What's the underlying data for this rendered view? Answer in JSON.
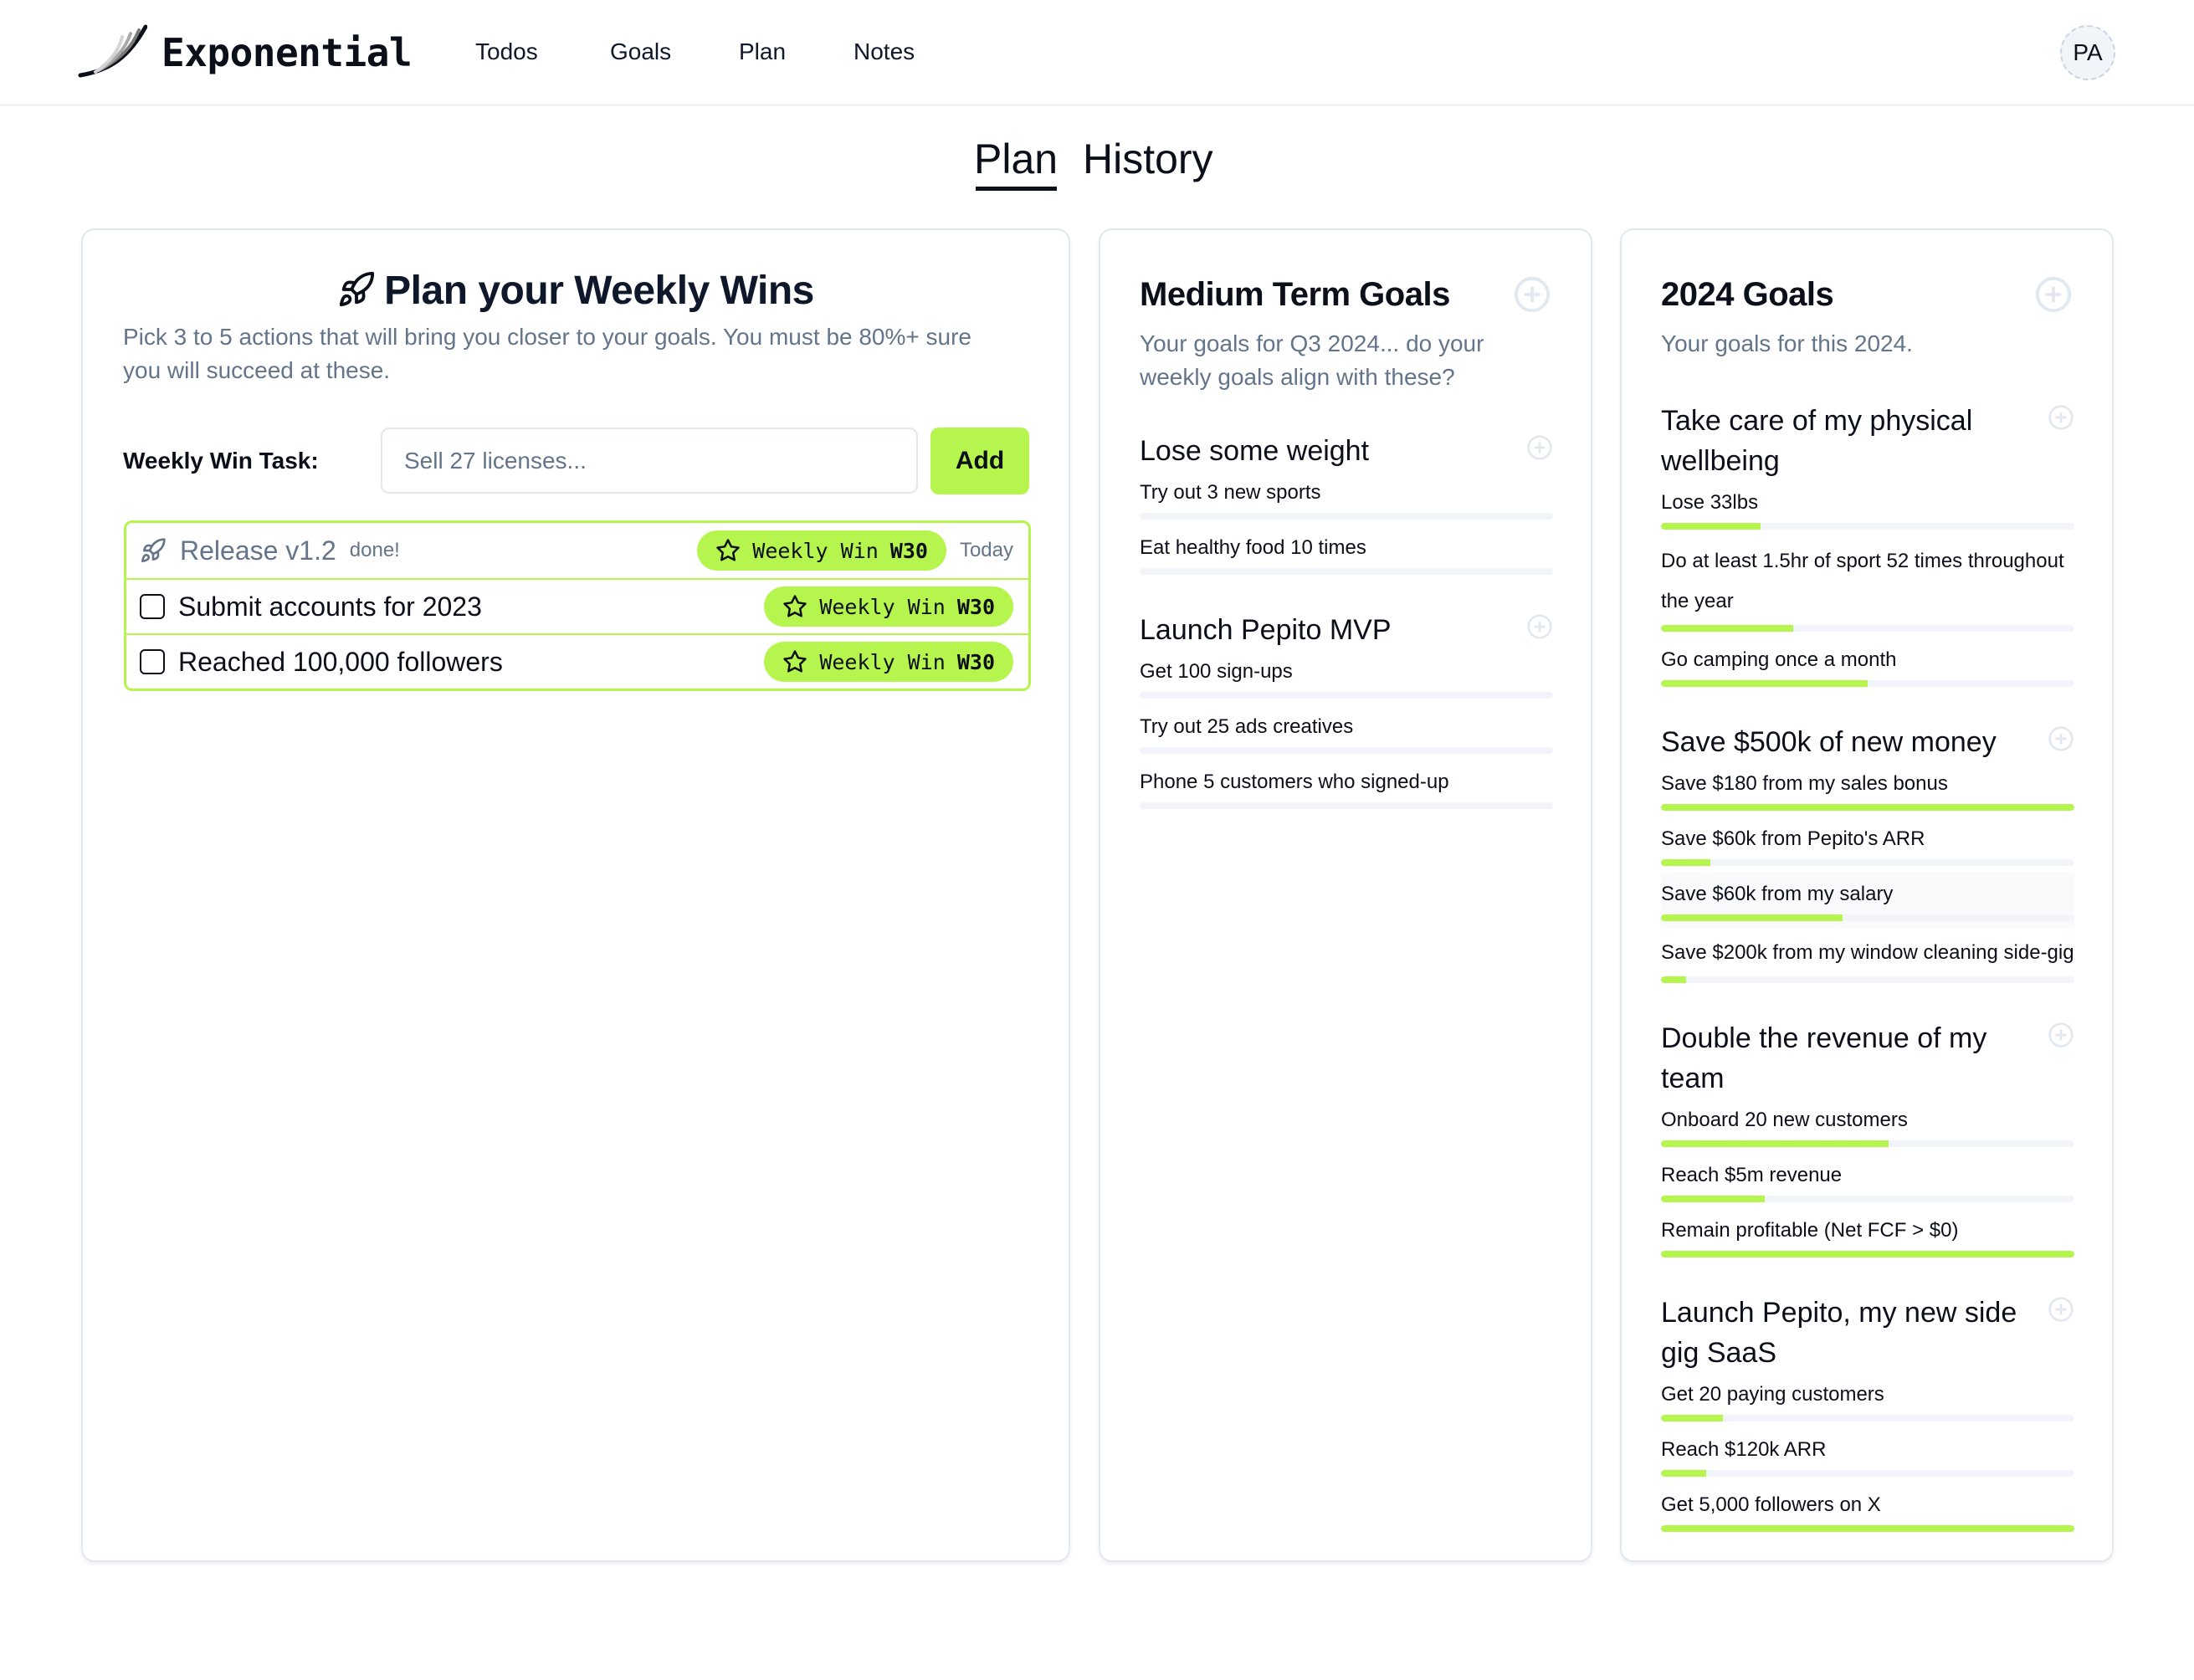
{
  "header": {
    "brand": "Exponential",
    "nav": [
      "Todos",
      "Goals",
      "Plan",
      "Notes"
    ],
    "avatar_initials": "PA"
  },
  "tabs": [
    {
      "label": "Plan",
      "active": true
    },
    {
      "label": "History",
      "active": false
    }
  ],
  "plan": {
    "title": "Plan your Weekly Wins",
    "title_icon": "rocket-icon",
    "description": "Pick 3 to 5 actions that will bring you closer to your goals. You must be 80%+ sure you will succeed at these.",
    "task_label": "Weekly Win Task:",
    "task_input_value": "",
    "task_input_placeholder": "Sell 27 licenses...",
    "add_label": "Add",
    "tasks": [
      {
        "text": "Release v1.2",
        "done": true,
        "done_label": "done!",
        "badge_label": "Weekly Win",
        "badge_week": "W30",
        "date": "Today"
      },
      {
        "text": "Submit accounts for 2023",
        "done": false,
        "badge_label": "Weekly Win",
        "badge_week": "W30"
      },
      {
        "text": "Reached 100,000 followers",
        "done": false,
        "badge_label": "Weekly Win",
        "badge_week": "W30"
      }
    ]
  },
  "medium_term": {
    "title": "Medium Term Goals",
    "description": "Your goals for Q3 2024... do your weekly goals align with these?",
    "goals": [
      {
        "title": "Lose some weight",
        "items": [
          {
            "text": "Try out 3 new sports",
            "progress": 0
          },
          {
            "text": "Eat healthy food 10 times",
            "progress": 0
          }
        ]
      },
      {
        "title": "Launch Pepito MVP",
        "items": [
          {
            "text": "Get 100 sign-ups",
            "progress": 0
          },
          {
            "text": "Try out 25 ads creatives",
            "progress": 0
          },
          {
            "text": "Phone 5 customers who signed-up",
            "progress": 0
          }
        ]
      }
    ]
  },
  "yearly": {
    "title": "2024 Goals",
    "description": "Your goals for this 2024.",
    "goals": [
      {
        "title": "Take care of my physical wellbeing",
        "items": [
          {
            "text": "Lose 33lbs",
            "progress": 24
          },
          {
            "text": "Do at least 1.5hr of sport 52 times throughout the year",
            "progress": 32
          },
          {
            "text": "Go camping once a month",
            "progress": 50
          }
        ]
      },
      {
        "title": "Save $500k of new money",
        "items": [
          {
            "text": "Save $180 from my sales bonus",
            "progress": 100
          },
          {
            "text": "Save $60k from Pepito's ARR",
            "progress": 12
          },
          {
            "text": "Save $60k from my salary",
            "progress": 44,
            "hovered": true
          },
          {
            "text": "Save $200k from my window cleaning side-gig",
            "progress": 6
          }
        ]
      },
      {
        "title": "Double the revenue of my team",
        "items": [
          {
            "text": "Onboard 20 new customers",
            "progress": 55
          },
          {
            "text": "Reach $5m revenue",
            "progress": 25
          },
          {
            "text": "Remain profitable (Net FCF > $0)",
            "progress": 100
          }
        ]
      },
      {
        "title": "Launch Pepito, my new side gig SaaS",
        "items": [
          {
            "text": "Get 20 paying customers",
            "progress": 15
          },
          {
            "text": "Reach $120k ARR",
            "progress": 11
          },
          {
            "text": "Get 5,000 followers on X",
            "progress": 100
          }
        ]
      }
    ]
  },
  "colors": {
    "accent": "#b6f54d",
    "text": "#0b0f19",
    "muted": "#64748b",
    "border": "#e2e8f0",
    "track": "#f1f5f9"
  }
}
